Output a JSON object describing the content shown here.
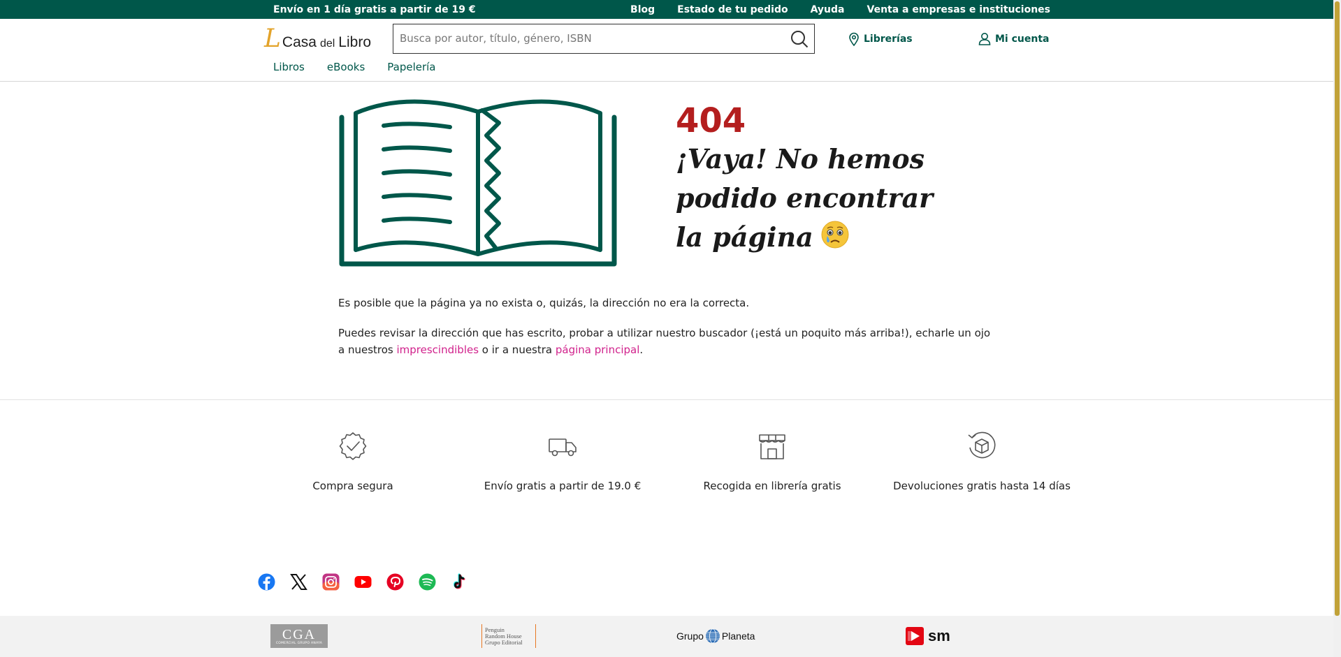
{
  "topbar": {
    "promo": "Envío en 1 día gratis a partir de 19 €",
    "links": [
      "Blog",
      "Estado de tu pedido",
      "Ayuda",
      "Venta a empresas e instituciones"
    ]
  },
  "header": {
    "logo": {
      "mark": "L",
      "part1": "Casa",
      "part2": "del",
      "part3": "Libro"
    },
    "search_placeholder": "Busca por autor, título, género, ISBN",
    "stores_label": "Librerías",
    "account_label": "Mi cuenta"
  },
  "nav": [
    "Libros",
    "eBooks",
    "Papelería"
  ],
  "error": {
    "code": "404",
    "headline": "¡Vaya! No hemos podido encontrar la página",
    "message1": "Es posible que la página ya no exista o, quizás, la dirección no era la correcta.",
    "message2_part1": "Puedes revisar la dirección que has escrito, probar a utilizar nuestro buscador (¡está un poquito más arriba!), echarle un ojo a nuestros ",
    "link_essentials": "imprescindibles",
    "message2_part2": " o ir a nuestra ",
    "link_home": "página principal",
    "message2_part3": "."
  },
  "features": [
    {
      "icon": "verified-badge-icon",
      "label": "Compra segura"
    },
    {
      "icon": "delivery-truck-icon",
      "label": "Envío gratis a partir de 19.0 €"
    },
    {
      "icon": "store-icon",
      "label": "Recogida en librería gratis"
    },
    {
      "icon": "return-box-icon",
      "label": "Devoluciones gratis hasta 14 días"
    }
  ],
  "social": [
    "facebook",
    "x",
    "instagram",
    "youtube",
    "pinterest",
    "spotify",
    "tiktok"
  ],
  "partners": {
    "cga": "CGA",
    "cga_sub": "COMERCIAL GRUPO ANAYA",
    "penguin_1": "Penguin",
    "penguin_2": "Random House",
    "penguin_3": "Grupo Editorial",
    "planeta_1": "Grupo",
    "planeta_2": "Planeta",
    "sm": "sm"
  },
  "colors": {
    "brand_green": "#00574a",
    "error_red": "#b41e1e",
    "link_pink": "#d1228c",
    "logo_gold": "#e3a32a"
  }
}
